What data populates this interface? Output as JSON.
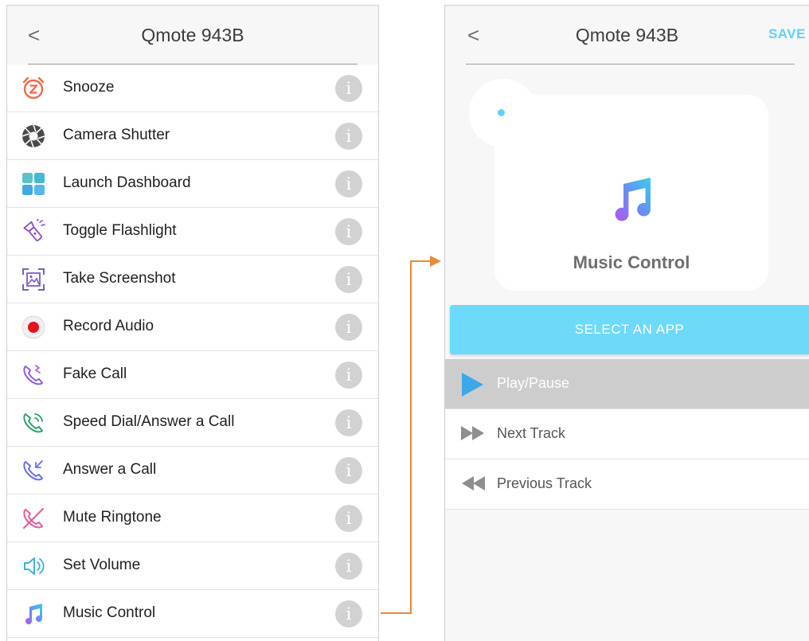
{
  "left_screen": {
    "header": {
      "back_icon": "chevron-left-icon",
      "back_glyph": "<",
      "title": "Qmote 943B"
    },
    "items": [
      {
        "label": "Snooze",
        "icon": "alarm-clock-z-icon"
      },
      {
        "label": "Camera Shutter",
        "icon": "camera-aperture-icon"
      },
      {
        "label": "Launch Dashboard",
        "icon": "dashboard-grid-icon"
      },
      {
        "label": "Toggle Flashlight",
        "icon": "flashlight-icon"
      },
      {
        "label": "Take Screenshot",
        "icon": "screenshot-icon"
      },
      {
        "label": "Record Audio",
        "icon": "record-icon"
      },
      {
        "label": "Fake Call",
        "icon": "fake-call-phone-icon"
      },
      {
        "label": "Speed Dial/Answer a Call",
        "icon": "speed-dial-phone-icon"
      },
      {
        "label": "Answer a Call",
        "icon": "answer-call-phone-icon"
      },
      {
        "label": "Mute Ringtone",
        "icon": "mute-ringtone-phone-icon"
      },
      {
        "label": "Set Volume",
        "icon": "speaker-volume-icon"
      },
      {
        "label": "Music Control",
        "icon": "music-note-icon"
      }
    ],
    "info_glyph": "i"
  },
  "right_screen": {
    "header": {
      "back_glyph": "<",
      "title": "Qmote 943B",
      "save_label": "SAVE"
    },
    "card": {
      "name": "Music Control",
      "icon": "music-note-icon"
    },
    "select_button": "SELECT AN APP",
    "options": [
      {
        "label": "Play/Pause",
        "icon": "play-icon",
        "selected": true
      },
      {
        "label": "Next Track",
        "icon": "fast-forward-icon",
        "selected": false
      },
      {
        "label": "Previous Track",
        "icon": "rewind-icon",
        "selected": false
      }
    ]
  },
  "colors": {
    "accent": "#6dd9fb",
    "connector": "#e98a3a",
    "selected_row": "#cdcdcd",
    "info_icon": "#d2d2d2"
  }
}
